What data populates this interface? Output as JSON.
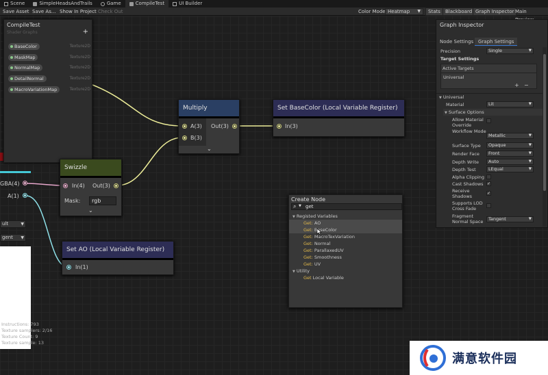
{
  "tabs": [
    {
      "label": "Scene",
      "icon": "scene-icon"
    },
    {
      "label": "SimpleHeadsAndTrails",
      "icon": "graph-icon"
    },
    {
      "label": "Game",
      "icon": "game-icon"
    },
    {
      "label": "CompileTest",
      "icon": "graph-icon",
      "active": true
    },
    {
      "label": "UI Builder",
      "icon": "builder-icon"
    }
  ],
  "toolbar": {
    "save_asset": "Save Asset",
    "save_as": "Save As...",
    "show_in_project": "Show In Project",
    "check_out": "Check Out",
    "color_mode_label": "Color Mode",
    "color_mode_value": "Heatmap",
    "stats": "Stats",
    "blackboard": "Blackboard",
    "graph_inspector": "Graph Inspector",
    "main_preview": "Main Preview"
  },
  "blackboard": {
    "title": "CompileTest",
    "subtitle": "Shader Graphs",
    "add": "+",
    "properties": [
      {
        "name": "BaseColor",
        "type": "Texture2D"
      },
      {
        "name": "MaskMap",
        "type": "Texture2D"
      },
      {
        "name": "NormalMap",
        "type": "Texture2D"
      },
      {
        "name": "DetailNormal",
        "type": "Texture2D"
      },
      {
        "name": "MacroVariationMap",
        "type": "Texture2D"
      }
    ]
  },
  "left_preview": {
    "port_rgba": "GBA(4)",
    "port_a": "A(1)",
    "dropdown1": "ult",
    "dropdown2": "gent"
  },
  "nodes": {
    "multiply": {
      "title": "Multiply",
      "in_a": "A(3)",
      "in_b": "B(3)",
      "out": "Out(3)",
      "header_color": "#2a3f63"
    },
    "set_basecolor": {
      "title": "Set BaseColor (Local Variable Register)",
      "in": "In(3)",
      "header_color": "#2d2d55"
    },
    "swizzle": {
      "title": "Swizzle",
      "in": "In(4)",
      "out": "Out(3)",
      "mask_label": "Mask:",
      "mask_value": "rgb",
      "header_color": "#3a4a1e"
    },
    "set_ao": {
      "title": "Set AO (Local Variable Register)",
      "in": "In(1)",
      "header_color": "#2d2d55"
    }
  },
  "inspector": {
    "title": "Graph Inspector",
    "tab_node": "Node Settings",
    "tab_graph": "Graph Settings",
    "precision_label": "Precision",
    "precision_value": "Single",
    "target_settings": "Target Settings",
    "active_targets": "Active Targets",
    "target_universal": "Universal",
    "list_add": "+",
    "list_remove": "−",
    "section_universal": "Universal",
    "material_label": "Material",
    "material_value": "Lit",
    "surface_options": "Surface Options",
    "allow_override_label": "Allow Material Override",
    "workflow_label": "Workflow Mode",
    "workflow_value": "Metallic",
    "surface_type_label": "Surface Type",
    "surface_type_value": "Opaque",
    "render_face_label": "Render Face",
    "render_face_value": "Front",
    "depth_write_label": "Depth Write",
    "depth_write_value": "Auto",
    "depth_test_label": "Depth Test",
    "depth_test_value": "LEqual",
    "alpha_clip_label": "Alpha Clipping",
    "cast_shadows_label": "Cast Shadows",
    "receive_shadows_label": "Receive Shadows",
    "lod_crossfade_label": "Supports LOD Cross Fade",
    "fragment_normal_label": "Fragment Normal Space",
    "fragment_normal_value": "Tangent",
    "checkmark": "✓"
  },
  "create_node": {
    "title": "Create Node",
    "search_value": "get",
    "group_registered": "Registed Variables",
    "get_prefix": "Get:",
    "registered_items": [
      "AO",
      "BaseColor",
      "MacroTexVariation",
      "Normal",
      "ParallaxedUV",
      "Smoothness",
      "UV"
    ],
    "group_utility": "Utility",
    "utility_get": "Get",
    "utility_item": "Local Variable"
  },
  "stats": {
    "instructions": "Instructions: 793",
    "texture_samplers": "Texture samplers: 2/16",
    "texture_count": "Texture Count: 9",
    "texture_sample": "Texture sample: 13"
  },
  "watermark": {
    "text": "满意软件园"
  }
}
